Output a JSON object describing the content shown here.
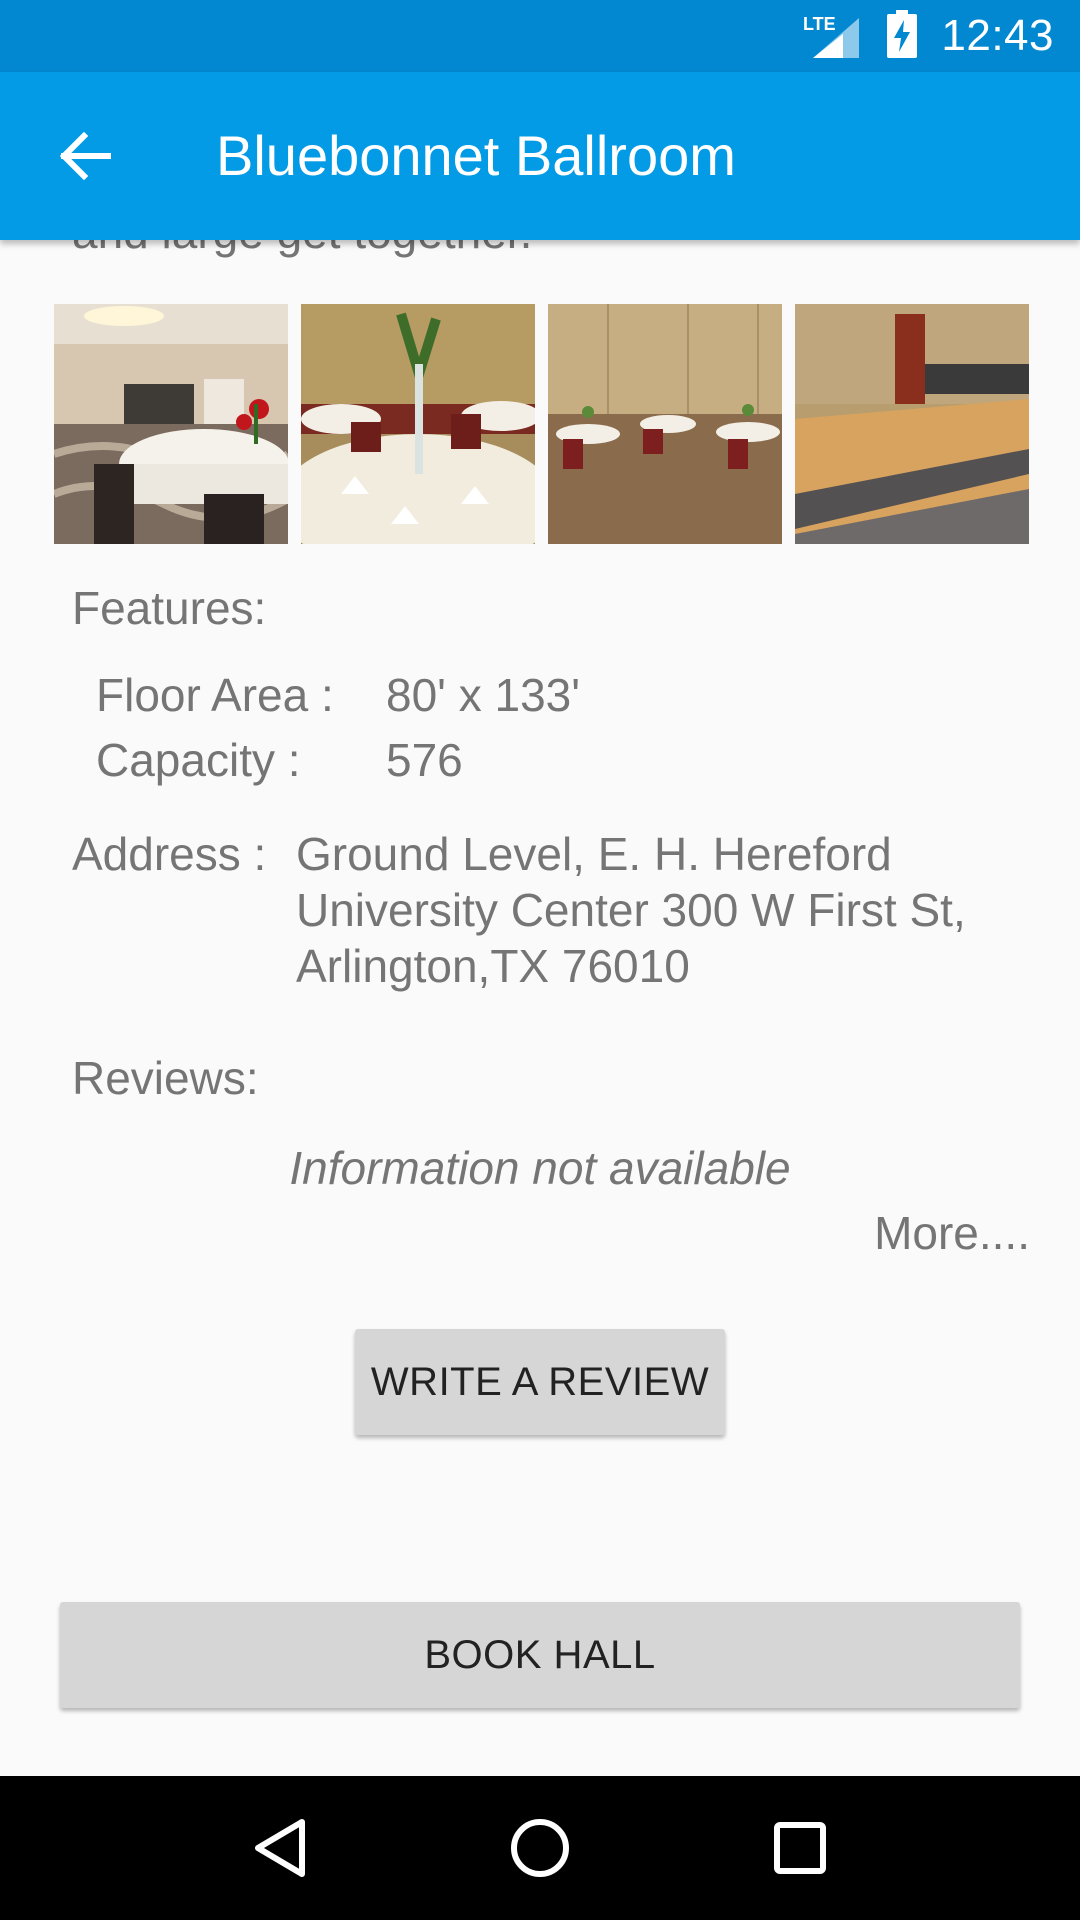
{
  "status_bar": {
    "time": "12:43",
    "network_label": "LTE"
  },
  "app_bar": {
    "title": "Bluebonnet Ballroom"
  },
  "description_tail": "and large get together.",
  "gallery": [
    {
      "icon": "ballroom-photo-1"
    },
    {
      "icon": "ballroom-photo-2"
    },
    {
      "icon": "ballroom-photo-3"
    },
    {
      "icon": "ballroom-photo-4"
    }
  ],
  "features": {
    "heading": "Features:",
    "floor_area_label": "Floor Area :",
    "floor_area_value": "80' x 133'",
    "capacity_label": "Capacity :",
    "capacity_value": "576"
  },
  "address": {
    "label": "Address :",
    "value": "Ground Level, E. H. Hereford University Center 300 W First St, Arlington,TX 76010"
  },
  "reviews": {
    "heading": "Reviews:",
    "empty_text": "Information not available",
    "more_link": "More...."
  },
  "buttons": {
    "write_review": "WRITE A REVIEW",
    "book_hall": "BOOK HALL"
  },
  "colors": {
    "status_bar": "#0288d1",
    "app_bar": "#039be5",
    "button_bg": "#d6d6d6",
    "text_secondary": "#757575"
  }
}
